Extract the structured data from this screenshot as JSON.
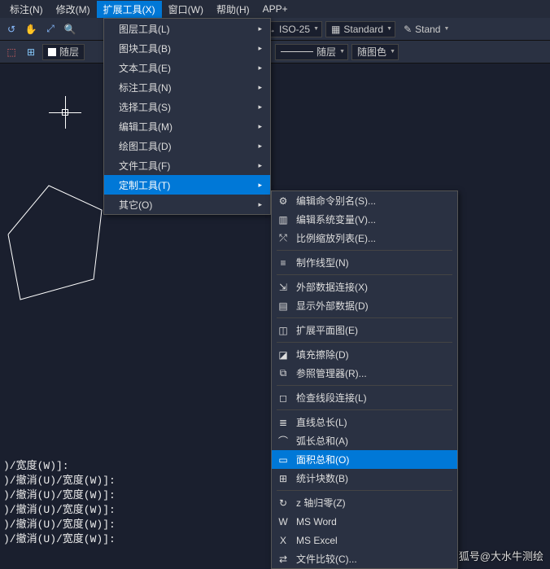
{
  "menubar": {
    "items": [
      "标注(N)",
      "修改(M)",
      "扩展工具(X)",
      "窗口(W)",
      "帮助(H)",
      "APP+"
    ],
    "active_index": 2
  },
  "toolbar1": {
    "dimstyle": "ISO-25",
    "textstyle": "Standard",
    "extra": "Stand"
  },
  "toolbar2": {
    "layer": "随层",
    "linetype": "随层",
    "color": "随图色"
  },
  "menu1": {
    "items": [
      "图层工具(L)",
      "图块工具(B)",
      "文本工具(E)",
      "标注工具(N)",
      "选择工具(S)",
      "编辑工具(M)",
      "绘图工具(D)",
      "文件工具(F)",
      "定制工具(T)",
      "其它(O)"
    ],
    "hl_index": 8
  },
  "submenu": {
    "groups": [
      [
        {
          "icon": "⚙",
          "label": "编辑命令别名(S)..."
        },
        {
          "icon": "▥",
          "label": "编辑系统变量(V)..."
        },
        {
          "icon": "⤱",
          "label": "比例缩放列表(E)..."
        }
      ],
      [
        {
          "icon": "≡",
          "label": "制作线型(N)"
        }
      ],
      [
        {
          "icon": "⇲",
          "label": "外部数据连接(X)"
        },
        {
          "icon": "▤",
          "label": "显示外部数据(D)"
        }
      ],
      [
        {
          "icon": "◫",
          "label": "扩展平面图(E)"
        }
      ],
      [
        {
          "icon": "◪",
          "label": "填充擦除(D)"
        },
        {
          "icon": "⧉",
          "label": "参照管理器(R)..."
        }
      ],
      [
        {
          "icon": "◻",
          "label": "检查线段连接(L)"
        }
      ],
      [
        {
          "icon": "≣",
          "label": "直线总长(L)"
        },
        {
          "icon": "⌒",
          "label": "弧长总和(A)"
        },
        {
          "icon": "▭",
          "label": "面积总和(O)"
        },
        {
          "icon": "⊞",
          "label": "统计块数(B)"
        }
      ],
      [
        {
          "icon": "↻",
          "label": "z 轴归零(Z)"
        },
        {
          "icon": "W",
          "label": "MS Word"
        },
        {
          "icon": "X",
          "label": "MS Excel"
        },
        {
          "icon": "⇄",
          "label": "文件比较(C)..."
        }
      ]
    ],
    "hl_label": "面积总和(O)"
  },
  "cmdlog": [
    ")/宽度(W)]:",
    ")/撤消(U)/宽度(W)]:",
    ")/撤消(U)/宽度(W)]:",
    ")/撤消(U)/宽度(W)]:",
    ")/撤消(U)/宽度(W)]:",
    ")/撤消(U)/宽度(W)]:"
  ],
  "watermark": "搜狐号@大水牛测绘"
}
